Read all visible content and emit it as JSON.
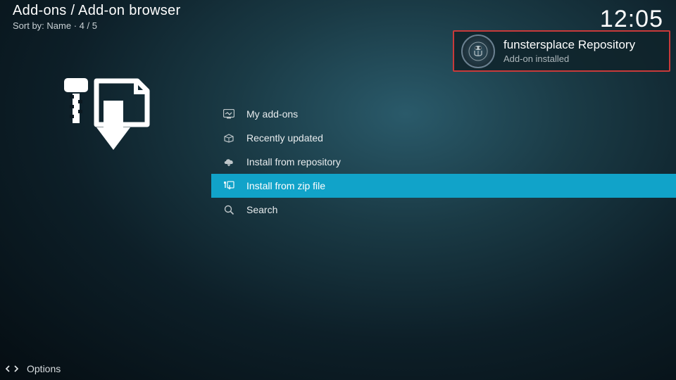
{
  "header": {
    "breadcrumb": "Add-ons / Add-on browser",
    "sort_label": "Sort by: Name  ·  4 / 5",
    "clock": "12:05"
  },
  "menu": {
    "items": [
      {
        "label": "My add-ons"
      },
      {
        "label": "Recently updated"
      },
      {
        "label": "Install from repository"
      },
      {
        "label": "Install from zip file"
      },
      {
        "label": "Search"
      }
    ]
  },
  "notification": {
    "title": "funstersplace Repository",
    "subtitle": "Add-on installed"
  },
  "footer": {
    "options_label": "Options"
  }
}
